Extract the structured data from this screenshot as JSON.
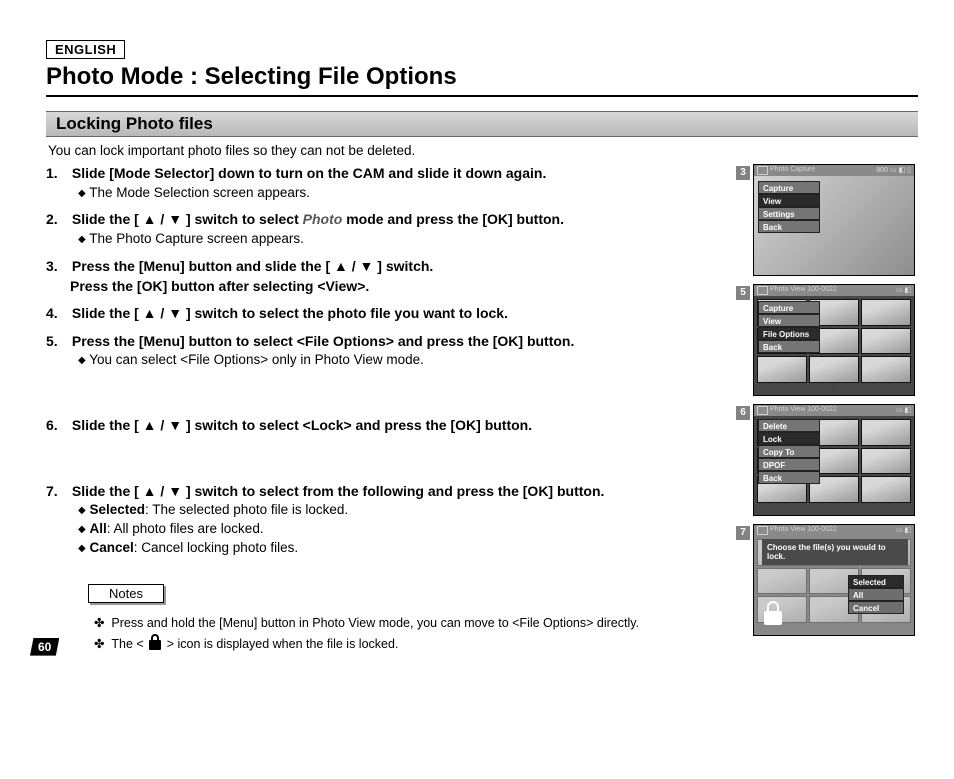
{
  "language": "ENGLISH",
  "title": "Photo Mode : Selecting File Options",
  "section": "Locking Photo files",
  "intro": "You can lock important photo files so they can not be deleted.",
  "steps": {
    "s1": {
      "num": "1.",
      "title": "Slide [Mode Selector] down to turn on the CAM and slide it down again.",
      "sub": [
        "The Mode Selection screen appears."
      ]
    },
    "s2": {
      "num": "2.",
      "title_pre": "Slide the [ ▲ / ▼ ] switch to select ",
      "title_em": "Photo",
      "title_post": " mode and press the [OK] button.",
      "sub": [
        "The Photo Capture screen appears."
      ]
    },
    "s3": {
      "num": "3.",
      "line1": "Press the [Menu] button and slide the [ ▲ / ▼ ] switch.",
      "line2": "Press the [OK] button after selecting <View>."
    },
    "s4": {
      "num": "4.",
      "title": "Slide the [ ▲ / ▼ ] switch to select the photo file you want to lock."
    },
    "s5": {
      "num": "5.",
      "title": "Press the [Menu] button to select <File Options> and press the [OK] button.",
      "sub": [
        "You can select <File Options> only in Photo View mode."
      ]
    },
    "s6": {
      "num": "6.",
      "title": "Slide the [ ▲ / ▼ ] switch to select <Lock> and press the [OK] button."
    },
    "s7": {
      "num": "7.",
      "title": "Slide the [ ▲ / ▼ ] switch to select from the following and press the [OK] button.",
      "opts": [
        {
          "b": "Selected",
          "t": ": The selected photo file is locked."
        },
        {
          "b": "All",
          "t": ": All photo files are locked."
        },
        {
          "b": "Cancel",
          "t": ": Cancel locking photo files."
        }
      ]
    }
  },
  "notes_label": "Notes",
  "notes": [
    "Press and hold the [Menu] button in Photo View mode, you can move to <File Options> directly.",
    "The < 🔒 > icon is displayed when the file is locked."
  ],
  "note2_pre": "The < ",
  "note2_post": " > icon is displayed when the file is locked.",
  "page_number": "60",
  "screens": {
    "s3": {
      "num": "3",
      "header": "Photo Capture",
      "badge": "800",
      "menu": [
        "Capture",
        "View",
        "Settings",
        "Back"
      ],
      "sel": 1
    },
    "s5": {
      "num": "5",
      "header": "Photo View 100-0022",
      "menu": [
        "Capture",
        "View",
        "File Options",
        "Back"
      ],
      "sel": 2
    },
    "s6": {
      "num": "6",
      "header": "Photo View 100-0022",
      "menu": [
        "Delete",
        "Lock",
        "Copy To",
        "DPOF",
        "Back"
      ],
      "sel": 1
    },
    "s7": {
      "num": "7",
      "header": "Photo View 100-0022",
      "prompt": "Choose the file(s) you would to lock.",
      "opts": [
        "Selected",
        "All",
        "Cancel"
      ],
      "sel": 0
    }
  }
}
